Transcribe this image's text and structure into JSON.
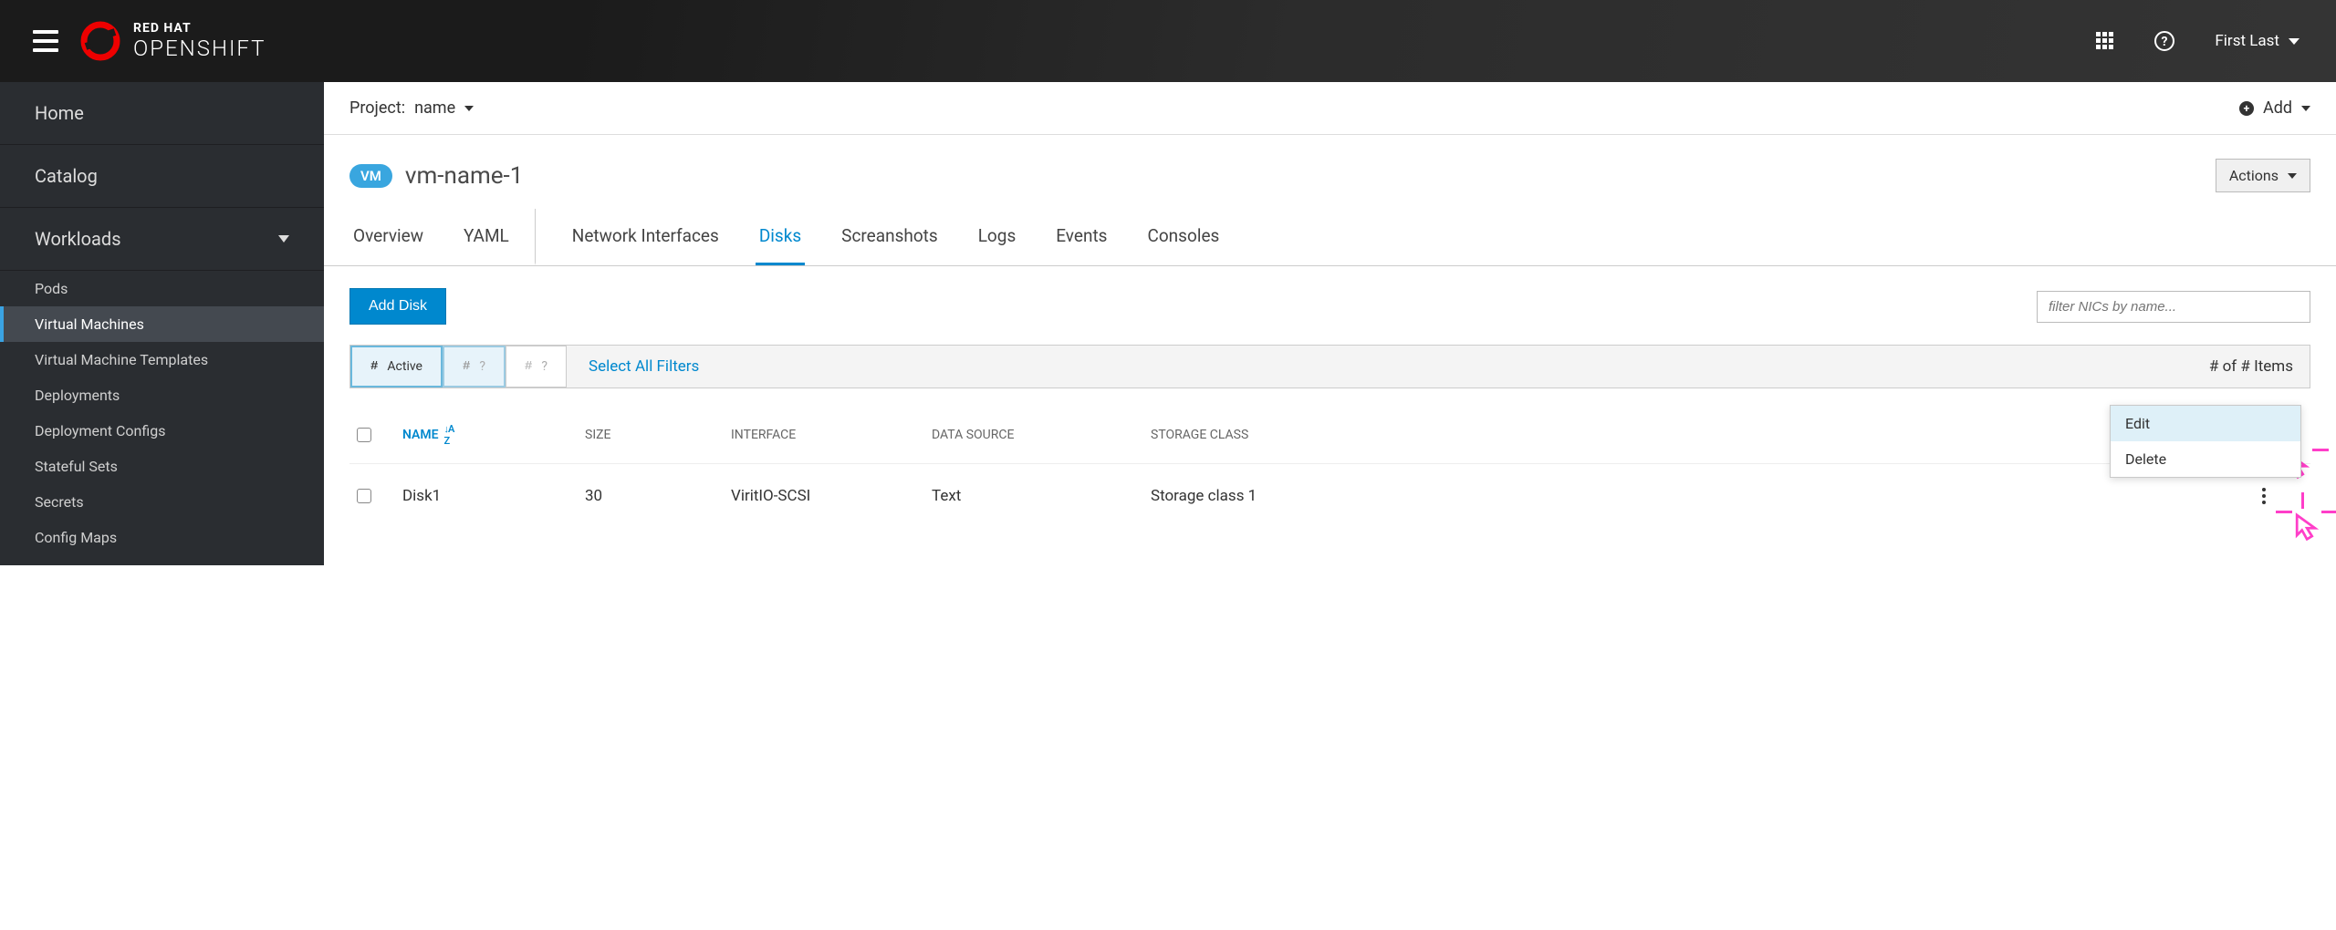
{
  "brand": {
    "line1": "RED HAT",
    "line2": "OPENSHIFT"
  },
  "user": {
    "display_name": "First Last"
  },
  "sidebar": {
    "home": "Home",
    "catalog": "Catalog",
    "workloads_label": "Workloads",
    "items": [
      "Pods",
      "Virtual Machines",
      "Virtual Machine Templates",
      "Deployments",
      "Deployment Configs",
      "Stateful Sets",
      "Secrets",
      "Config Maps"
    ]
  },
  "project_bar": {
    "label": "Project:",
    "value": "name",
    "add_label": "Add"
  },
  "page": {
    "badge": "VM",
    "title": "vm-name-1",
    "actions_label": "Actions"
  },
  "tabs": [
    "Overview",
    "YAML",
    "Network Interfaces",
    "Disks",
    "Screanshots",
    "Logs",
    "Events",
    "Consoles"
  ],
  "active_tab_index": 3,
  "toolbar": {
    "add_disk": "Add Disk",
    "filter_placeholder": "filter NICs by name..."
  },
  "filters": {
    "chip_hash": "#",
    "chip1_label": "Active",
    "chip_q": "?",
    "select_all": "Select All Filters",
    "items_count": "# of # Items"
  },
  "table": {
    "headers": {
      "name": "NAME",
      "size": "SIZE",
      "interface": "INTERFACE",
      "data_source": "DATA SOURCE",
      "storage_class": "STORAGE CLASS"
    },
    "rows": [
      {
        "name": "Disk1",
        "size": "30",
        "interface": "ViritIO-SCSI",
        "data_source": "Text",
        "storage_class": "Storage class 1"
      }
    ]
  },
  "row_menu": {
    "edit": "Edit",
    "delete": "Delete"
  }
}
